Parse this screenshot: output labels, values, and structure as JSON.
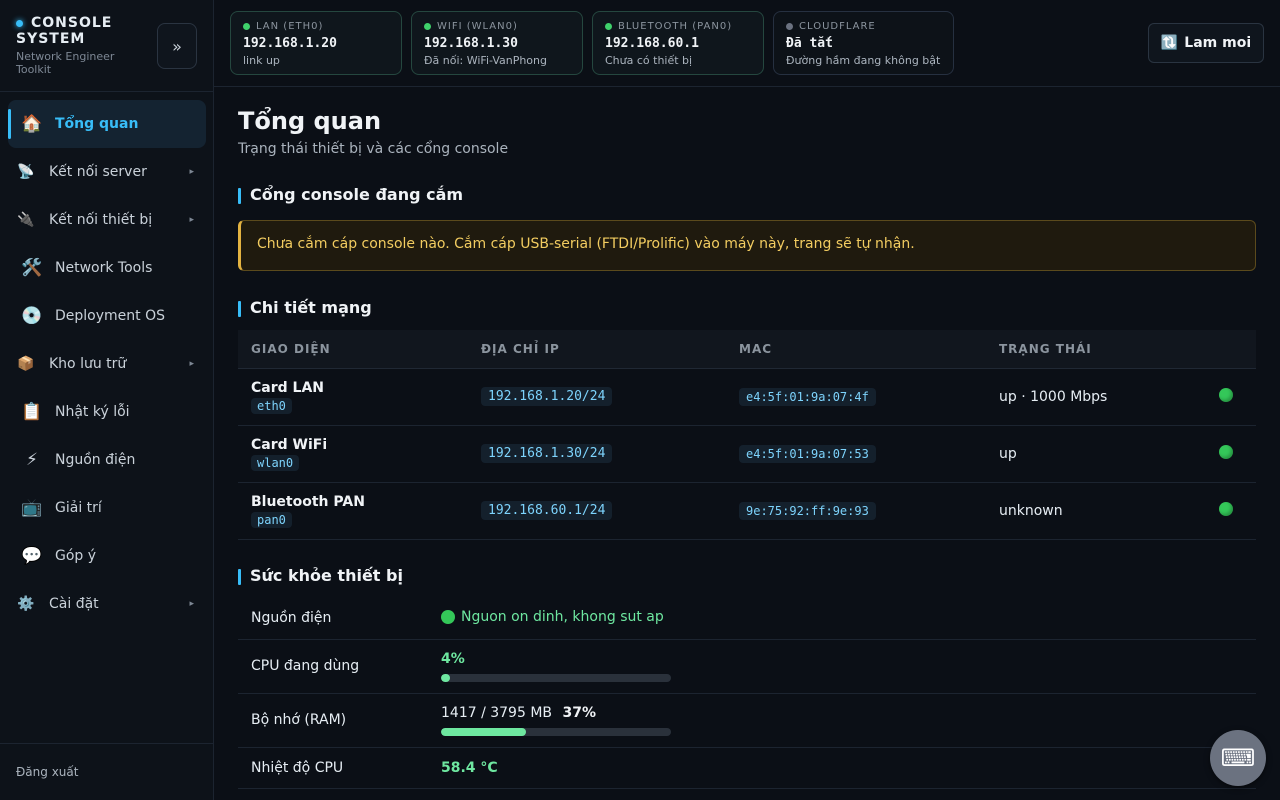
{
  "brand": {
    "title": "CONSOLE SYSTEM",
    "subtitle": "Network Engineer Toolkit",
    "collapse_label": "»"
  },
  "sidebar": {
    "items": [
      {
        "label": "Tổng quan",
        "icon": "house-icon",
        "glyph": "🏠",
        "active": true,
        "has_sub": false
      },
      {
        "label": "Kết nối server",
        "icon": "satellite-icon",
        "glyph": "📡",
        "has_sub": true
      },
      {
        "label": "Kết nối thiết bị",
        "icon": "plug-icon",
        "glyph": "🔌",
        "has_sub": true
      },
      {
        "label": "Network Tools",
        "icon": "tools-icon",
        "glyph": "🛠️",
        "has_sub": false
      },
      {
        "label": "Deployment OS",
        "icon": "disc-icon",
        "glyph": "💿",
        "has_sub": false
      },
      {
        "label": "Kho lưu trữ",
        "icon": "package-icon",
        "glyph": "📦",
        "has_sub": true
      },
      {
        "label": "Nhật ký lỗi",
        "icon": "clipboard-icon",
        "glyph": "📋",
        "has_sub": false
      },
      {
        "label": "Nguồn điện",
        "icon": "lightning-icon",
        "glyph": "⚡",
        "has_sub": false
      },
      {
        "label": "Giải trí",
        "icon": "tv-icon",
        "glyph": "📺",
        "has_sub": false
      },
      {
        "label": "Góp ý",
        "icon": "speech-bubble-icon",
        "glyph": "💬",
        "has_sub": false
      },
      {
        "label": "Cài đặt",
        "icon": "gear-icon",
        "glyph": "⚙️",
        "has_sub": true
      }
    ],
    "chevron": "▸",
    "logout": "Đăng xuất"
  },
  "topbar": {
    "interfaces": [
      {
        "label": "LAN (ETH0)",
        "value": "192.168.1.20",
        "sub": "link up",
        "on": true
      },
      {
        "label": "WIFI (WLAN0)",
        "value": "192.168.1.30",
        "sub": "Đã nối: WiFi-VanPhong",
        "on": true
      },
      {
        "label": "BLUETOOTH (PAN0)",
        "value": "192.168.60.1",
        "sub": "Chưa có thiết bị",
        "on": true
      },
      {
        "label": "CLOUDFLARE",
        "value": "Đã tắt",
        "sub": "Đường hầm đang không bật",
        "on": false
      }
    ],
    "refresh_icon": "🔃",
    "refresh_label": "Lam moi"
  },
  "main": {
    "title": "Tổng quan",
    "subtitle": "Trạng thái thiết bị và các cổng console",
    "console_section": "Cổng console đang cắm",
    "console_alert": "Chưa cắm cáp console nào. Cắm cáp USB-serial (FTDI/Prolific) vào máy này, trang sẽ tự nhận.",
    "network_section": "Chi tiết mạng",
    "table_headers": [
      "GIAO DIỆN",
      "ĐỊA CHỈ IP",
      "MAC",
      "TRẠNG THÁI"
    ],
    "table_rows": [
      {
        "name": "Card LAN",
        "iface": "eth0",
        "ip": "192.168.1.20/24",
        "mac": "e4:5f:01:9a:07:4f",
        "status": "up · 1000 Mbps"
      },
      {
        "name": "Card WiFi",
        "iface": "wlan0",
        "ip": "192.168.1.30/24",
        "mac": "e4:5f:01:9a:07:53",
        "status": "up"
      },
      {
        "name": "Bluetooth PAN",
        "iface": "pan0",
        "ip": "192.168.60.1/24",
        "mac": "9e:75:92:ff:9e:93",
        "status": "unknown"
      }
    ],
    "health_section": "Sức khỏe thiết bị",
    "health": {
      "power_label": "Nguồn điện",
      "power_value": "Nguon on dinh, khong sut ap",
      "cpu_label": "CPU đang dùng",
      "cpu_pct": "4%",
      "cpu_fraction": 0.04,
      "ram_label": "Bộ nhớ (RAM)",
      "ram_value": "1417 / 3795 MB",
      "ram_pct": "37%",
      "ram_fraction": 0.37,
      "temp_label": "Nhiệt độ CPU",
      "temp_value": "58.4 °C"
    }
  },
  "fab": {
    "icon": "keyboard-icon",
    "glyph": "⌨"
  },
  "colors": {
    "accent": "#38bdf8",
    "ok": "#6ee7a0",
    "warn": "#f2cc60",
    "bg": "#0b0f16"
  }
}
